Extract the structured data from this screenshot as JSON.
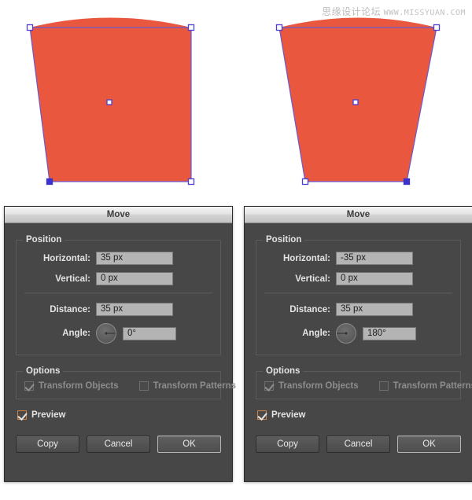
{
  "watermark": {
    "cn": "思缘设计论坛",
    "url": "WWW.MISSYUAN.COM"
  },
  "artwork": {
    "left_shape_name": "trapezoid-shape-left",
    "right_shape_name": "trapezoid-shape-right",
    "fill_color": "#e9573f",
    "path_stroke_color": "#6a5acd",
    "anchor_color": "#ffffff",
    "anchor_border_color": "#4b3fd4",
    "anchor_selected_color": "#3b33cf"
  },
  "dialogs": [
    {
      "id": "left",
      "title": "Move",
      "position_group": {
        "legend": "Position",
        "horizontal_label": "Horizontal:",
        "horizontal_value": "35 px",
        "vertical_label": "Vertical:",
        "vertical_value": "0 px",
        "distance_label": "Distance:",
        "distance_value": "35 px",
        "angle_label": "Angle:",
        "angle_value": "0°",
        "angle_degrees": 0
      },
      "options_group": {
        "legend": "Options",
        "transform_objects_label": "Transform Objects",
        "transform_objects_checked": true,
        "transform_patterns_label": "Transform Patterns",
        "transform_patterns_checked": false
      },
      "preview_label": "Preview",
      "preview_checked": true,
      "buttons": {
        "copy": "Copy",
        "cancel": "Cancel",
        "ok": "OK"
      }
    },
    {
      "id": "right",
      "title": "Move",
      "position_group": {
        "legend": "Position",
        "horizontal_label": "Horizontal:",
        "horizontal_value": "-35 px",
        "vertical_label": "Vertical:",
        "vertical_value": "0 px",
        "distance_label": "Distance:",
        "distance_value": "35 px",
        "angle_label": "Angle:",
        "angle_value": "180°",
        "angle_degrees": 180
      },
      "options_group": {
        "legend": "Options",
        "transform_objects_label": "Transform Objects",
        "transform_objects_checked": true,
        "transform_patterns_label": "Transform Patterns",
        "transform_patterns_checked": false
      },
      "preview_label": "Preview",
      "preview_checked": true,
      "buttons": {
        "copy": "Copy",
        "cancel": "Cancel",
        "ok": "OK"
      }
    }
  ]
}
